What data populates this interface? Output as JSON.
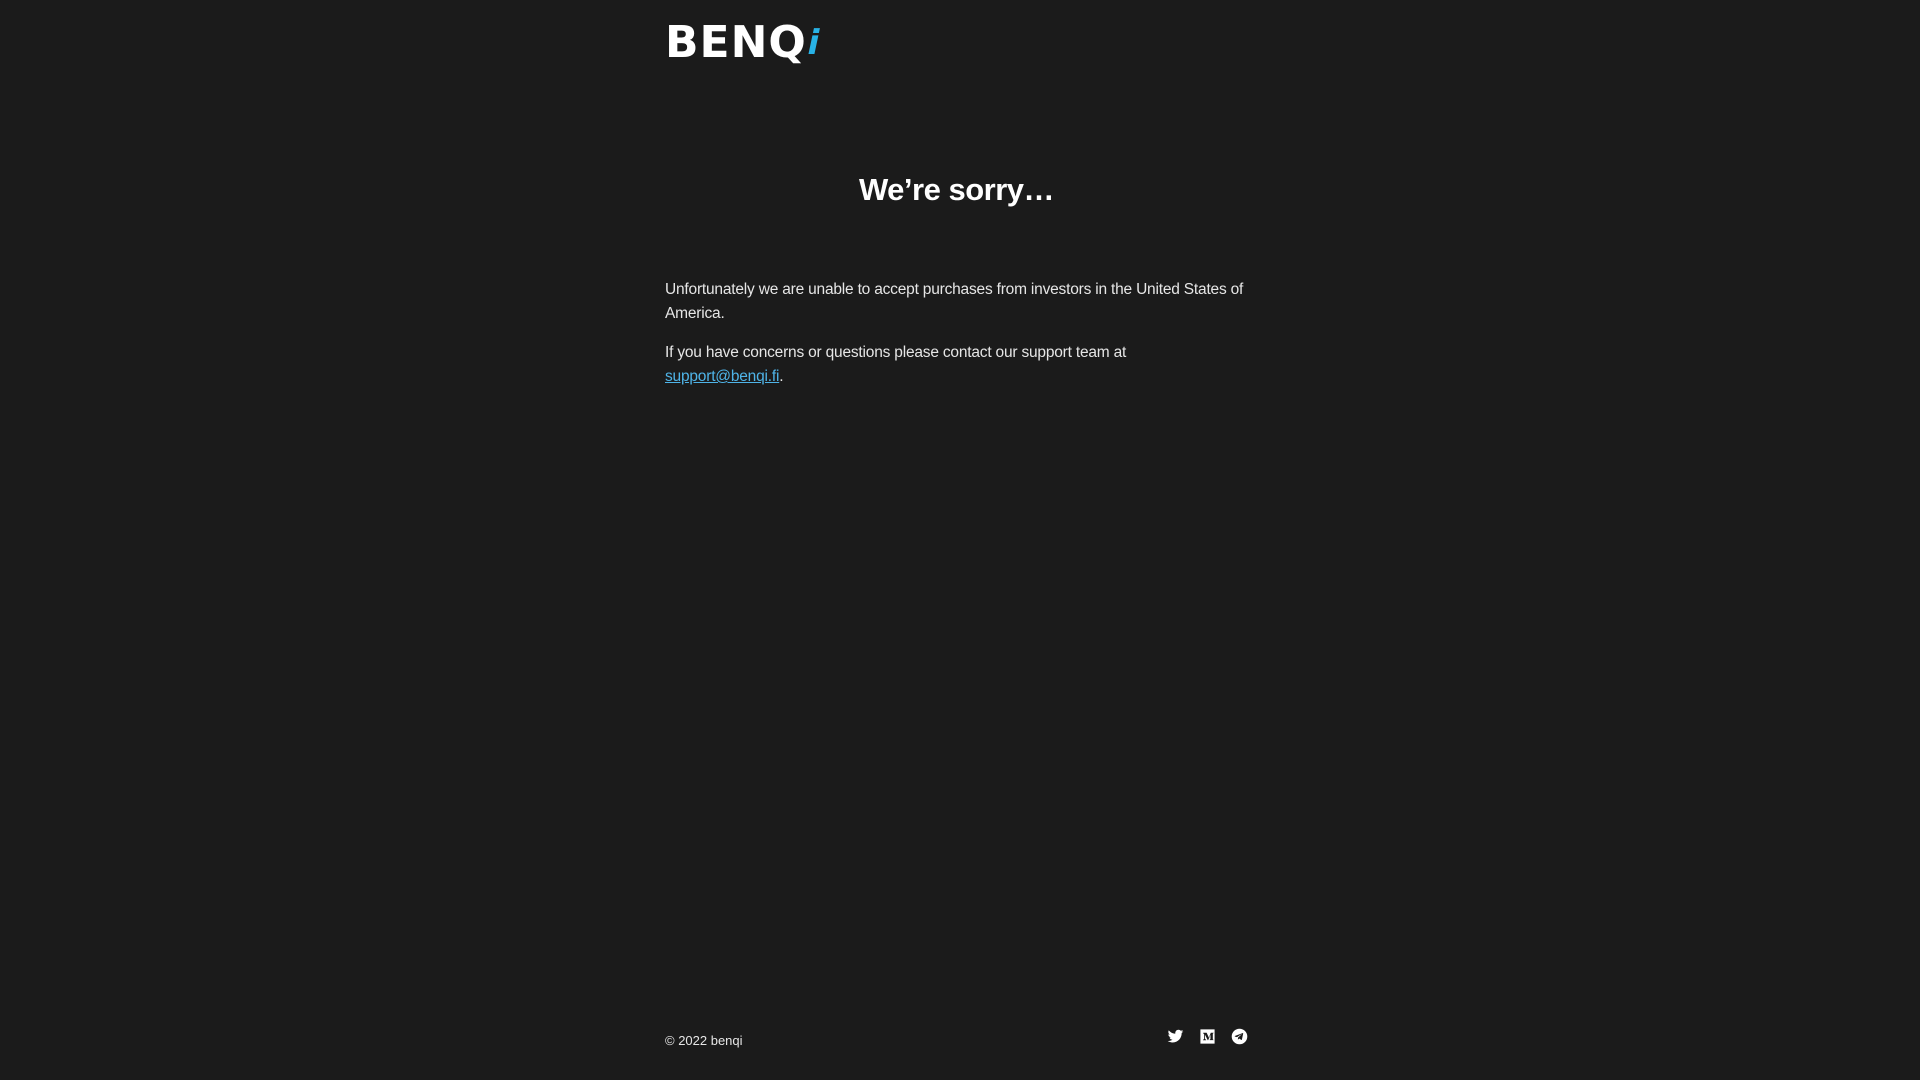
{
  "brand": {
    "logo_text": "BENQ",
    "logo_accent": "i"
  },
  "main": {
    "title": "We’re sorry…",
    "paragraph1": "Unfortunately we are unable to accept purchases from investors in the United States of America.",
    "paragraph2_prefix": "If you have concerns or questions please contact our support team at ",
    "support_email": "support@benqi.fi",
    "paragraph2_suffix": "."
  },
  "footer": {
    "copyright": "© 2022 benqi",
    "socials": [
      "twitter-icon",
      "medium-icon",
      "telegram-icon"
    ]
  },
  "colors": {
    "background": "#1b1b1b",
    "accent": "#28b2e6",
    "link": "#4fb4e8",
    "text": "#e6e6e6"
  }
}
